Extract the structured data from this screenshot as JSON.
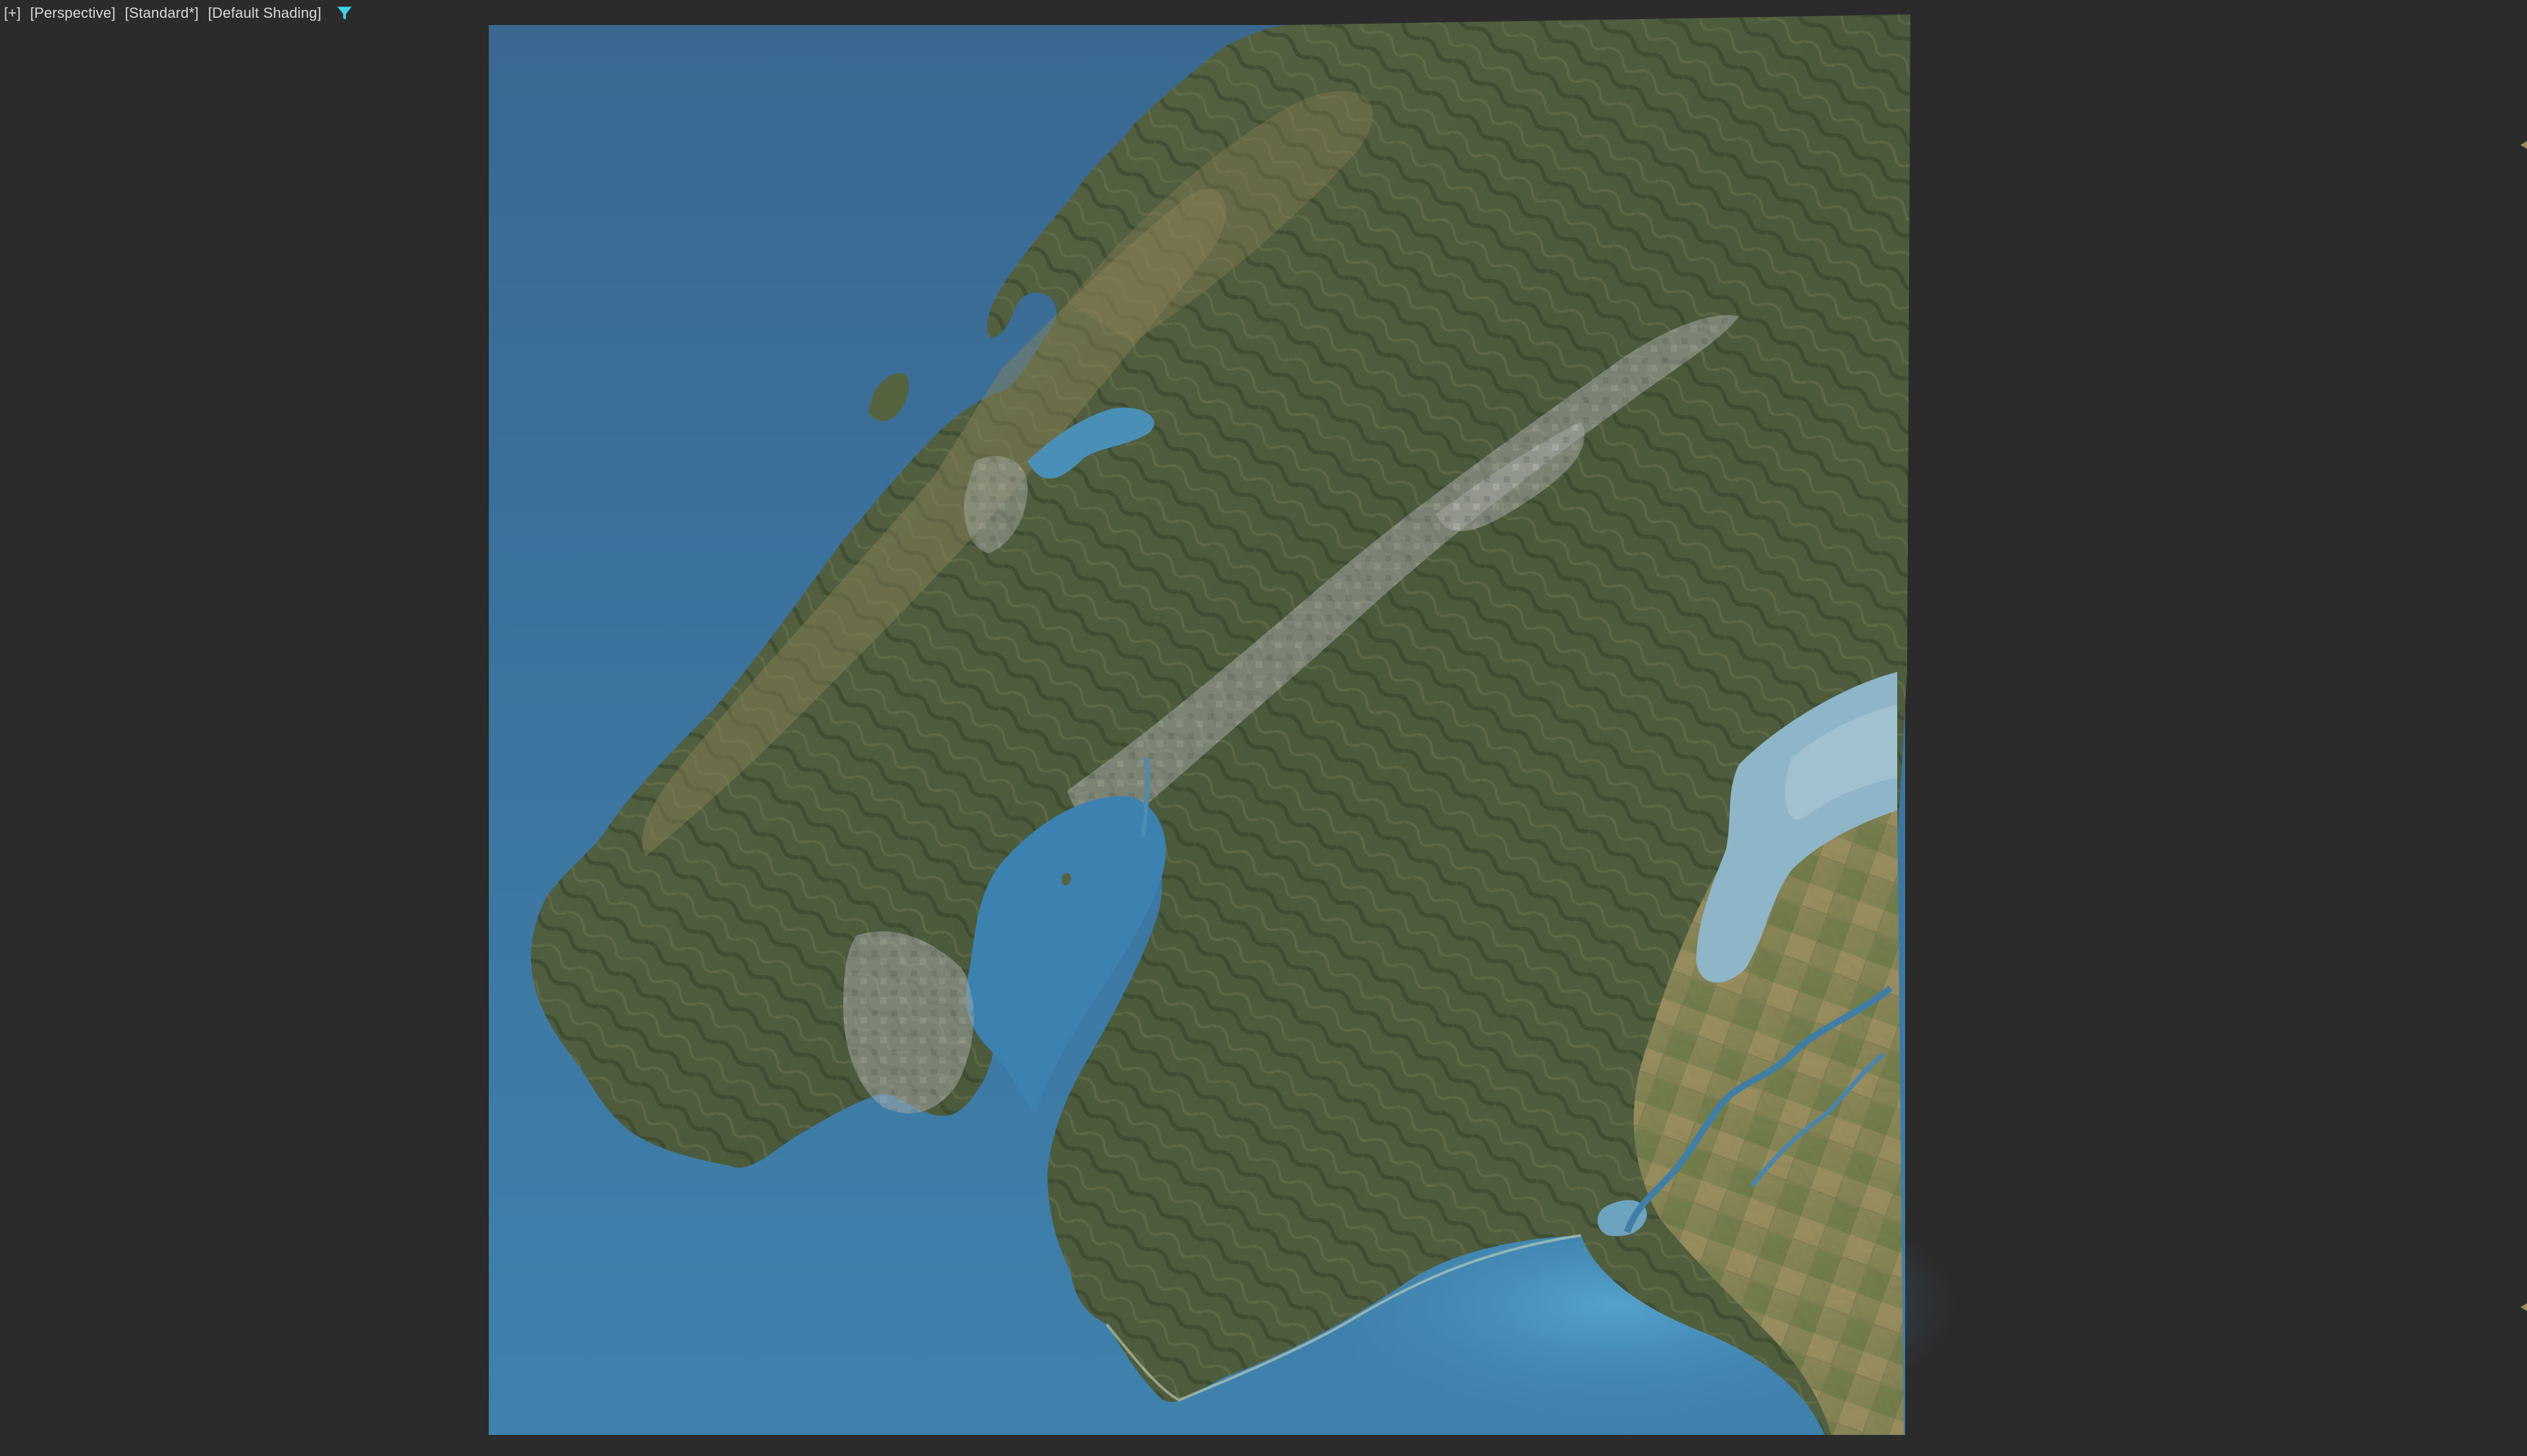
{
  "viewport": {
    "labels": {
      "menu": "[+]",
      "view": "[Perspective]",
      "renderer": "[Standard*]",
      "shading": "[Default Shading]"
    },
    "filter_icon": "filter-icon",
    "accent_color": "#3fd2e8"
  },
  "terrain": {
    "content": "3D terrain mesh with satellite texture (coastline, mountains, harbour, lake)",
    "colors": {
      "sea_deep": "#3a6a92",
      "sea_mid": "#3d7aa6",
      "sea_shallow": "#4f9cc2",
      "lake": "#8bb3c6",
      "forest": "#4c5c3e",
      "forest_dark": "#3a4a30",
      "grassland": "#8a8457",
      "farmland": "#a89968",
      "urban": "#a4a7a4"
    }
  }
}
